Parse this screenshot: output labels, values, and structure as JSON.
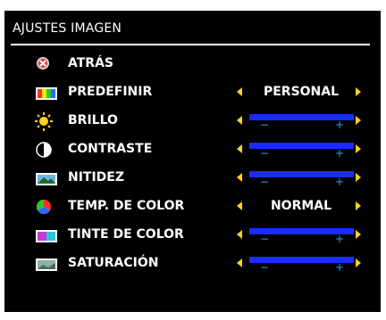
{
  "menu": {
    "title": "AJUSTES IMAGEN",
    "items": [
      {
        "label": "ATRÁS",
        "icon": "back-x-icon",
        "control": "none"
      },
      {
        "label": "PREDEFINIR",
        "icon": "preset-color-bars-icon",
        "control": "select",
        "value": "PERSONAL"
      },
      {
        "label": "BRILLO",
        "icon": "brightness-sun-icon",
        "control": "slider",
        "minus": "−",
        "plus": "+"
      },
      {
        "label": "CONTRASTE",
        "icon": "contrast-icon",
        "control": "slider",
        "minus": "−",
        "plus": "+"
      },
      {
        "label": "NITIDEZ",
        "icon": "sharpness-landscape-icon",
        "control": "slider",
        "minus": "−",
        "plus": "+"
      },
      {
        "label": "TEMP. DE COLOR",
        "icon": "color-temp-icon",
        "control": "select",
        "value": "NORMAL"
      },
      {
        "label": "TINTE DE COLOR",
        "icon": "tint-icon",
        "control": "slider",
        "minus": "−",
        "plus": "+"
      },
      {
        "label": "SATURACIÓN",
        "icon": "saturation-icon",
        "control": "slider",
        "minus": "−",
        "plus": "+"
      }
    ]
  },
  "colors": {
    "background": "#000000",
    "text": "#ffffff",
    "arrow": "#ffd21f",
    "slider": "#1a2cff",
    "slider_marks": "#1ea7ff"
  }
}
